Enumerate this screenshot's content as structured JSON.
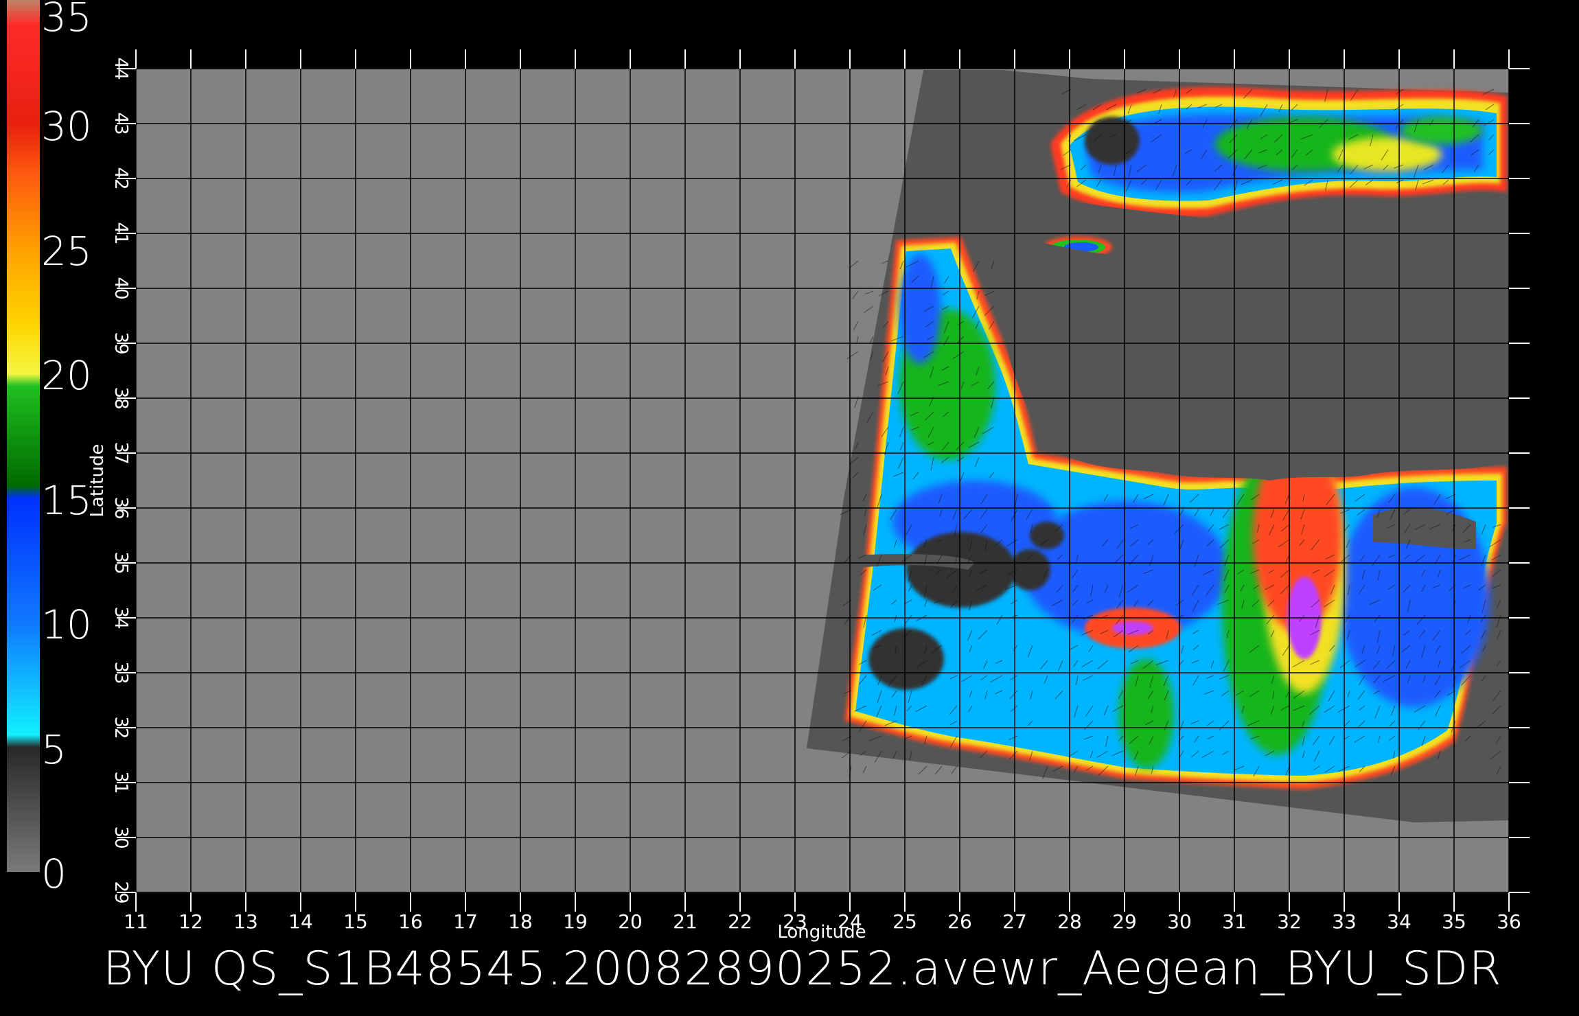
{
  "title": "BYU  QS_S1B48545.20082890252.avewr_Aegean_BYU_SDR",
  "colorbar": {
    "labels": [
      "35",
      "30",
      "25",
      "20",
      "15",
      "10",
      "5",
      "0"
    ],
    "stops": [
      {
        "value": 35,
        "color": "#c0856a"
      },
      {
        "value": 34,
        "color": "#ff2a2a"
      },
      {
        "value": 30,
        "color": "#e82010"
      },
      {
        "value": 28,
        "color": "#ff5a10"
      },
      {
        "value": 25,
        "color": "#ffa000"
      },
      {
        "value": 22,
        "color": "#ffd400"
      },
      {
        "value": 20,
        "color": "#f6f640"
      },
      {
        "value": 19.5,
        "color": "#20c020"
      },
      {
        "value": 15.5,
        "color": "#006a00"
      },
      {
        "value": 15,
        "color": "#0030ff"
      },
      {
        "value": 10,
        "color": "#1078ff"
      },
      {
        "value": 5.5,
        "color": "#10f0ff"
      },
      {
        "value": 5,
        "color": "#282828"
      },
      {
        "value": 0,
        "color": "#7a7a7a"
      }
    ]
  },
  "map": {
    "xlabel": "Longitude",
    "ylabel": "Latitude",
    "lon_range": [
      11,
      36
    ],
    "lat_range": [
      29,
      44
    ],
    "lon_ticks": [
      "11",
      "12",
      "13",
      "14",
      "15",
      "16",
      "17",
      "18",
      "19",
      "20",
      "21",
      "22",
      "23",
      "24",
      "25",
      "26",
      "27",
      "28",
      "29",
      "30",
      "31",
      "32",
      "33",
      "34",
      "35",
      "36"
    ],
    "lat_ticks": [
      "29",
      "30",
      "31",
      "32",
      "33",
      "34",
      "35",
      "36",
      "37",
      "38",
      "39",
      "40",
      "41",
      "42",
      "43",
      "44"
    ],
    "background_color": "#828282",
    "swath_color": "#555555"
  }
}
